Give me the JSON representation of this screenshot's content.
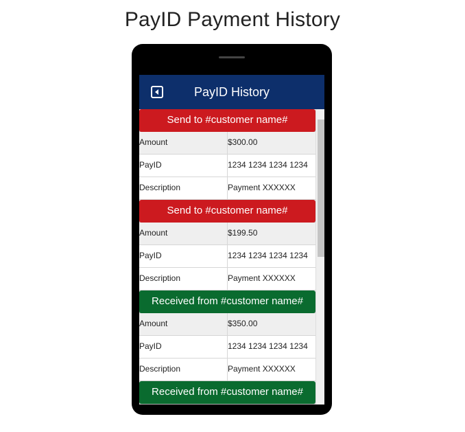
{
  "page": {
    "title": "PayID Payment History"
  },
  "app": {
    "header_title": "PayID History",
    "back_icon": "back-icon"
  },
  "labels": {
    "amount": "Amount",
    "payid": "PayID",
    "description": "Description"
  },
  "transactions": [
    {
      "kind": "send",
      "header": "Send to #customer name#",
      "amount": "$300.00",
      "payid": "1234 1234 1234 1234",
      "description": "Payment XXXXXX"
    },
    {
      "kind": "send",
      "header": "Send to #customer name#",
      "amount": "$199.50",
      "payid": "1234 1234 1234 1234",
      "description": "Payment XXXXXX"
    },
    {
      "kind": "received",
      "header": "Received from #customer name#",
      "amount": "$350.00",
      "payid": "1234 1234 1234 1234",
      "description": "Payment XXXXXX"
    },
    {
      "kind": "received",
      "header": "Received from #customer name#"
    }
  ],
  "colors": {
    "header_bg": "#0d2f6b",
    "send": "#cc1a1f",
    "received": "#0a6b2f"
  }
}
